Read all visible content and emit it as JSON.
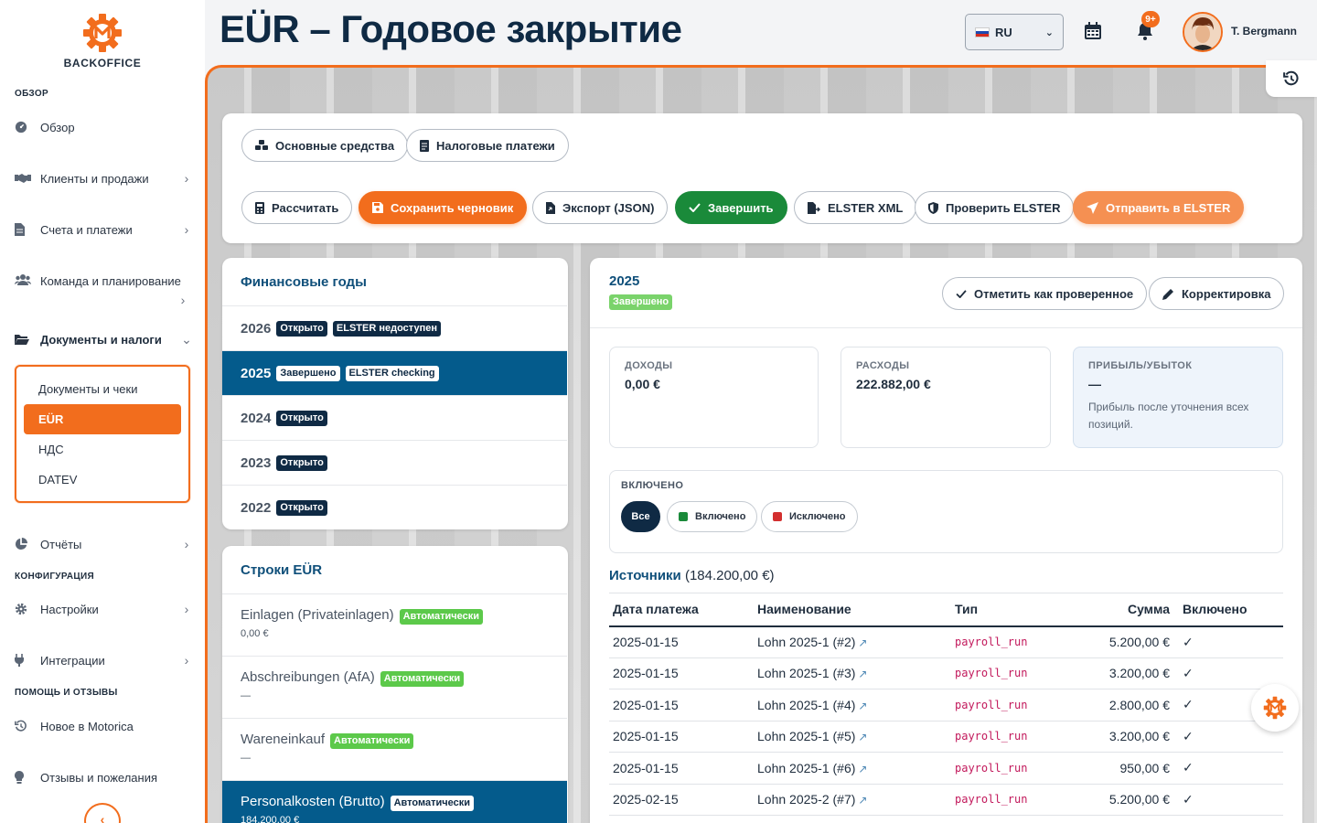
{
  "app": {
    "logo_text": "BACKOFFICE",
    "page_title": "EÜR – Годовое закрытие",
    "colors": {
      "accent": "#f26d1d",
      "primary": "#045b8c",
      "dark": "#0f2a44",
      "success": "#1a8a3a"
    }
  },
  "header": {
    "language": "RU",
    "notifications_badge": "9+",
    "user_name": "T. Bergmann"
  },
  "sidebar": {
    "sections": {
      "overview": "ОБЗОР",
      "config": "КОНФИГУРАЦИЯ",
      "help": "ПОМОЩЬ И ОТЗЫВЫ"
    },
    "items": {
      "overview": "Обзор",
      "clients": "Клиенты и продажи",
      "invoices": "Счета и платежи",
      "team": "Команда и планирование",
      "documents": "Документы и налоги",
      "reports": "Отчёты",
      "settings": "Настройки",
      "integrations": "Интеграции",
      "whats_new": "Новое в Motorica",
      "feedback": "Отзывы и пожелания"
    },
    "sub_items": {
      "docs": "Документы и чеки",
      "eur": "EÜR",
      "vat": "НДС",
      "datev": "DATEV"
    }
  },
  "toolbar": {
    "fixed_assets": "Основные средства",
    "tax_payments": "Налоговые платежи",
    "calculate": "Рассчитать",
    "save_draft": "Сохранить черновик",
    "export_json": "Экспорт (JSON)",
    "finish": "Завершить",
    "elster_xml": "ELSTER XML",
    "check_elster": "Проверить ELSTER",
    "send_elster": "Отправить в ELSTER"
  },
  "years_card": {
    "title": "Финансовые годы",
    "rows": [
      {
        "year": "2026",
        "status": "Открыто",
        "extra": "ELSTER недоступен"
      },
      {
        "year": "2025",
        "status": "Завершено",
        "extra": "ELSTER checking"
      },
      {
        "year": "2024",
        "status": "Открыто",
        "extra": ""
      },
      {
        "year": "2023",
        "status": "Открыто",
        "extra": ""
      },
      {
        "year": "2022",
        "status": "Открыто",
        "extra": ""
      }
    ]
  },
  "lines_card": {
    "title": "Строки EÜR",
    "rows": [
      {
        "name": "Einlagen (Privateinlagen)",
        "tag": "Автоматически",
        "value": "0,00 €"
      },
      {
        "name": "Abschreibungen (AfA)",
        "tag": "Автоматически",
        "value": "—"
      },
      {
        "name": "Wareneinkauf",
        "tag": "Автоматически",
        "value": "—"
      },
      {
        "name": "Personalkosten (Brutto)",
        "tag": "Автоматически",
        "value": "184.200,00 €"
      }
    ]
  },
  "detail": {
    "year": "2025",
    "status": "Завершено",
    "mark_checked": "Отметить как проверенное",
    "correction": "Корректировка",
    "income_label": "ДОХОДЫ",
    "income_value": "0,00 €",
    "expense_label": "РАСХОДЫ",
    "expense_value": "222.882,00 €",
    "profit_label": "ПРИБЫЛЬ/УБЫТОК",
    "profit_value": "—",
    "profit_note": "Прибыль после уточнения всех позиций.",
    "filter_label": "ВКЛЮЧЕНО",
    "filter_all": "Все",
    "filter_included": "Включено",
    "filter_excluded": "Исключено",
    "sources_title": "Источники",
    "sources_total": "(184.200,00 €)",
    "columns": [
      "Дата платежа",
      "Наименование",
      "Тип",
      "Сумма",
      "Включено"
    ],
    "rows": [
      {
        "date": "2025-01-15",
        "name": "Lohn 2025-1 (#2)",
        "type": "payroll_run",
        "amount": "5.200,00 €",
        "included": "✓"
      },
      {
        "date": "2025-01-15",
        "name": "Lohn 2025-1 (#3)",
        "type": "payroll_run",
        "amount": "3.200,00 €",
        "included": "✓"
      },
      {
        "date": "2025-01-15",
        "name": "Lohn 2025-1 (#4)",
        "type": "payroll_run",
        "amount": "2.800,00 €",
        "included": "✓"
      },
      {
        "date": "2025-01-15",
        "name": "Lohn 2025-1 (#5)",
        "type": "payroll_run",
        "amount": "3.200,00 €",
        "included": "✓"
      },
      {
        "date": "2025-01-15",
        "name": "Lohn 2025-1 (#6)",
        "type": "payroll_run",
        "amount": "950,00 €",
        "included": "✓"
      },
      {
        "date": "2025-02-15",
        "name": "Lohn 2025-2 (#7)",
        "type": "payroll_run",
        "amount": "5.200,00 €",
        "included": "✓"
      }
    ]
  }
}
